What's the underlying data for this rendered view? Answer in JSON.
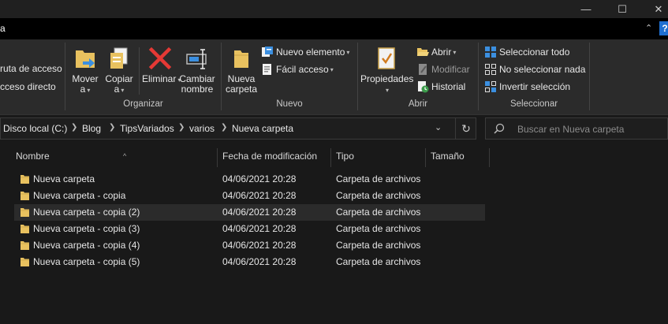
{
  "window": {
    "tab_visible": "a",
    "min_glyph": "—",
    "max_glyph": "☐",
    "close_glyph": "✕",
    "collapse_glyph": "⌃",
    "help_glyph": "?"
  },
  "ribbon": {
    "clipboard_partial": {
      "copy_path": "ruta de acceso",
      "paste_shortcut": "cceso directo"
    },
    "organizar": {
      "label": "Organizar",
      "move_to": [
        "Mover",
        "a"
      ],
      "copy_to": [
        "Copiar",
        "a"
      ],
      "delete": "Eliminar",
      "rename": [
        "Cambiar",
        "nombre"
      ]
    },
    "nuevo": {
      "label": "Nuevo",
      "new_folder": [
        "Nueva",
        "carpeta"
      ],
      "new_item": "Nuevo elemento",
      "easy_access": "Fácil acceso"
    },
    "abrir": {
      "label": "Abrir",
      "properties": "Propiedades",
      "open": "Abrir",
      "edit": "Modificar",
      "history": "Historial"
    },
    "seleccionar": {
      "label": "Seleccionar",
      "select_all": "Seleccionar todo",
      "select_none": "No seleccionar nada",
      "invert": "Invertir selección"
    }
  },
  "address": {
    "crumbs": [
      "Disco local (C:)",
      "Blog",
      "TipsVariados",
      "varios",
      "Nueva carpeta"
    ],
    "search_placeholder": "Buscar en Nueva carpeta"
  },
  "columns": {
    "name": "Nombre",
    "date": "Fecha de modificación",
    "type": "Tipo",
    "size": "Tamaño"
  },
  "files": [
    {
      "name": "Nueva carpeta",
      "date": "04/06/2021 20:28",
      "type": "Carpeta de archivos"
    },
    {
      "name": "Nueva carpeta - copia",
      "date": "04/06/2021 20:28",
      "type": "Carpeta de archivos"
    },
    {
      "name": "Nueva carpeta - copia (2)",
      "date": "04/06/2021 20:28",
      "type": "Carpeta de archivos"
    },
    {
      "name": "Nueva carpeta - copia (3)",
      "date": "04/06/2021 20:28",
      "type": "Carpeta de archivos"
    },
    {
      "name": "Nueva carpeta - copia (4)",
      "date": "04/06/2021 20:28",
      "type": "Carpeta de archivos"
    },
    {
      "name": "Nueva carpeta - copia (5)",
      "date": "04/06/2021 20:28",
      "type": "Carpeta de archivos"
    }
  ],
  "colors": {
    "background": "#191919",
    "ribbon": "#2b2b2b",
    "folder": "#e8c15f",
    "accent": "#1f6fd1"
  }
}
